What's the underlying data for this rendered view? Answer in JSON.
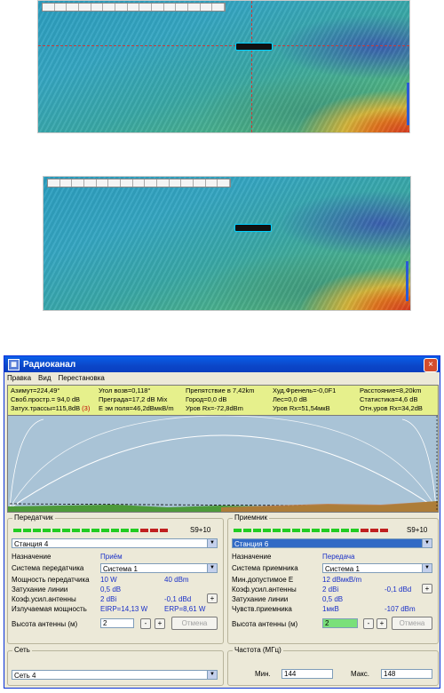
{
  "window": {
    "title": "Радиоканал",
    "close": "×",
    "icon": "app-icon"
  },
  "menu": [
    "Правка",
    "Вид",
    "Перестановка"
  ],
  "info": {
    "row1": [
      "Азимут=224,49°",
      "Угол возв=0,118°",
      "Препятствие в 7,42km",
      "Худ.Френель=-0,0F1",
      "Расстояние=8,20km"
    ],
    "row2": [
      "Своб.простр.= 94,0 dB",
      "Преграда=17,2 dB Mix",
      "Город=0,0 dB",
      "Лес=0,0 dB",
      "Статистика=4,6 dB"
    ],
    "row3_a": "Затух.трассы=115,8dB",
    "row3_a_flag": "(3)",
    "row3": [
      "Е эм поля=46,2dBмкВ/m",
      "Уров Rx=-72,8dBm",
      "Уров Rx=51,54мкВ",
      "Отн.уров Rx=34,2dB"
    ]
  },
  "transmitter": {
    "group": "Передатчик",
    "signal_text": "S9+10",
    "station": "Станция   4",
    "purpose_label": "Назначение",
    "purpose_value": "Приём",
    "system_label": "Система передатчика",
    "system_value": "Система   1",
    "power_label": "Мощность передатчика",
    "power_w": "10 W",
    "power_dbm": "40 dBm",
    "loss_label": "Затухание линии",
    "loss_value": "0,5 dB",
    "gain_label": "Коэф.усил.антенны",
    "gain_dbi": "2 dBi",
    "gain_dbd": "-0,1 dBd",
    "gain_btn": "+",
    "eirp_label": "Излучаемая мощность",
    "eirp": "EIRP=14,13 W",
    "erp": "ERP=8,61 W",
    "height_label": "Высота антенны (м)",
    "height_value": "2",
    "minus": "-",
    "plus": "+",
    "cancel": "Отмена"
  },
  "receiver": {
    "group": "Приемник",
    "signal_text": "S9+10",
    "station": "Станция   6",
    "purpose_label": "Назначение",
    "purpose_value": "Передача",
    "system_label": "Система приемника",
    "system_value": "Система   1",
    "min_e_label": "Мин.допустимое Е",
    "min_e_value": "12 dBмкВ/m",
    "gain_label": "Коэф.усил.антенны",
    "gain_dbi": "2 dBi",
    "gain_dbd": "-0,1 dBd",
    "gain_btn": "+",
    "loss_label": "Затухание линии",
    "loss_value": "0,5 dB",
    "sens_label": "Чувств.приемника",
    "sens_uv": "1мкВ",
    "sens_dbm": "-107 dBm",
    "height_label": "Высота антенны (м)",
    "height_value": "2",
    "minus": "-",
    "plus": "+",
    "cancel": "Отмена"
  },
  "network": {
    "group": "Сеть",
    "value": "Сеть  4"
  },
  "frequency": {
    "group": "Частота (МГц)",
    "min_label": "Мин.",
    "min_value": "144",
    "max_label": "Макс.",
    "max_value": "148"
  }
}
